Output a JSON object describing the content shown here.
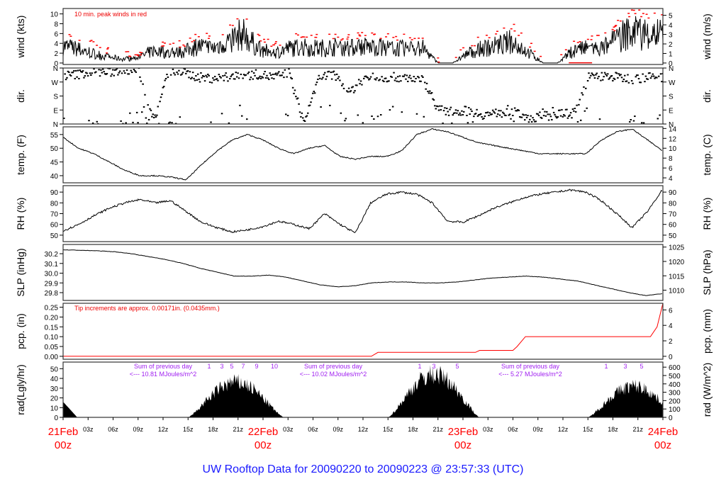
{
  "chart_data": {
    "type": "line",
    "title": "UW Rooftop Data for 20090220  to  20090223 @ 23:57:33  (UTC)",
    "x_hours_step": 3,
    "x_ticks": [
      "03z",
      "06z",
      "09z",
      "12z",
      "15z",
      "18z",
      "21z"
    ],
    "date_labels": [
      {
        "date": "21Feb",
        "hour": "00z"
      },
      {
        "date": "22Feb",
        "hour": "00z"
      },
      {
        "date": "23Feb",
        "hour": "00z"
      },
      {
        "date": "24Feb",
        "hour": "00z"
      }
    ],
    "panels": [
      {
        "id": "wind",
        "ylabel": "wind (kts)",
        "ylabel_right": "wind (m/s)",
        "ylim": [
          -0.3,
          11.1
        ],
        "ticks": [
          "0",
          "2",
          "4",
          "6",
          "8",
          "10"
        ],
        "tick_values": [
          0,
          2,
          4,
          6,
          8,
          10
        ],
        "ticks_right": [
          "0",
          "1",
          "2",
          "3",
          "4",
          "5"
        ],
        "note": "10 min. peak winds in red",
        "values": [
          3.5,
          2.8,
          2,
          1.2,
          0.8,
          1,
          2.5,
          2,
          2.2,
          3.5,
          3,
          4.5,
          6,
          3,
          2,
          3,
          3.2,
          3,
          3.3,
          3,
          3.4,
          3.2,
          3,
          3,
          3,
          0,
          0,
          2,
          3,
          3.5,
          4.5,
          2.2,
          0,
          0,
          2.5,
          3,
          3,
          5,
          6.5,
          6
        ]
      },
      {
        "id": "dir",
        "ylabel": "dir.",
        "ylabel_right": "dir.",
        "ylim": [
          0,
          360
        ],
        "ticks": [
          "N",
          "E",
          "S",
          "W",
          "N"
        ],
        "tick_values": [
          0,
          90,
          180,
          270,
          360
        ],
        "values": [
          310,
          320,
          340,
          330,
          350,
          340,
          20,
          345,
          330,
          300,
          295,
          300,
          310,
          320,
          300,
          330,
          10,
          300,
          320,
          200,
          290,
          300,
          300,
          300,
          280,
          90,
          80,
          85,
          60,
          70,
          75,
          40,
          50,
          60,
          70,
          300,
          310,
          300,
          290,
          300
        ]
      },
      {
        "id": "temp",
        "ylabel": "temp. (F)",
        "ylabel_right": "temp. (C)",
        "ylim": [
          37.4,
          57.8
        ],
        "ticks": [
          "40",
          "45",
          "50",
          "55"
        ],
        "tick_values": [
          40,
          45,
          50,
          55
        ],
        "ticks_right": [
          "4",
          "6",
          "8",
          "10",
          "12",
          "14"
        ],
        "values": [
          54,
          50,
          48,
          45,
          42,
          40,
          40,
          39.5,
          38.5,
          44,
          49,
          53,
          55,
          53,
          50,
          48,
          50,
          51,
          47,
          46,
          47,
          47,
          49,
          55,
          57,
          56,
          54,
          52,
          51,
          50,
          49,
          48,
          48,
          48,
          48,
          53,
          56,
          57,
          53,
          49
        ]
      },
      {
        "id": "rh",
        "ylabel": "RH (%)",
        "ylabel_right": "RH (%)",
        "ylim": [
          44,
          96
        ],
        "ticks": [
          "50",
          "60",
          "70",
          "80",
          "90"
        ],
        "tick_values": [
          50,
          60,
          70,
          80,
          90
        ],
        "values": [
          54,
          60,
          68,
          75,
          80,
          83,
          80,
          82,
          72,
          62,
          57,
          53,
          55,
          58,
          63,
          60,
          56,
          70,
          60,
          52,
          80,
          88,
          90,
          88,
          80,
          63,
          62,
          68,
          75,
          80,
          85,
          88,
          90,
          92,
          90,
          82,
          70,
          57,
          72,
          93
        ]
      },
      {
        "id": "slp",
        "ylabel": "SLP (inHg)",
        "ylabel_right": "SLP (hPa)",
        "ylim": [
          29.72,
          30.295
        ],
        "ticks": [
          "29.8",
          "29.9",
          "30.0",
          "30.1",
          "30.2"
        ],
        "tick_values": [
          29.8,
          29.9,
          30,
          30.1,
          30.2
        ],
        "ticks_right": [
          "1010",
          "1015",
          "1020",
          "1025"
        ],
        "values": [
          30.24,
          30.235,
          30.23,
          30.22,
          30.2,
          30.17,
          30.14,
          30.1,
          30.05,
          30.01,
          29.97,
          29.97,
          29.98,
          29.96,
          29.92,
          29.88,
          29.86,
          29.87,
          29.9,
          29.91,
          29.91,
          29.9,
          29.9,
          29.91,
          29.93,
          29.95,
          29.96,
          29.97,
          29.96,
          29.94,
          29.92,
          29.88,
          29.84,
          29.8,
          29.77,
          29.79
        ]
      },
      {
        "id": "pcp",
        "ylabel": "pcp. (in)",
        "ylabel_right": "pcp. (mm)",
        "ylim": [
          -0.015,
          0.27
        ],
        "ticks": [
          "0.00",
          "0.05",
          "0.10",
          "0.15",
          "0.20",
          "0.25"
        ],
        "tick_values": [
          0,
          0.05,
          0.1,
          0.15,
          0.2,
          0.25
        ],
        "ticks_right": [
          "0",
          "2",
          "4",
          "6"
        ],
        "note": "Tip increments are approx. 0.00171in. (0.0435mm.)",
        "steps": [
          [
            0,
            0
          ],
          [
            37,
            0
          ],
          [
            37.8,
            0.02
          ],
          [
            49.5,
            0.02
          ],
          [
            50,
            0.03
          ],
          [
            54,
            0.03
          ],
          [
            54.5,
            0.05
          ],
          [
            55.5,
            0.1
          ],
          [
            70.5,
            0.1
          ],
          [
            71.3,
            0.15
          ],
          [
            72,
            0.27
          ]
        ]
      },
      {
        "id": "rad",
        "ylabel": "rad(Lgly/hr)",
        "ylabel_right": "rad (W/m^2)",
        "ylim": [
          0,
          56.8
        ],
        "ticks": [
          "0",
          "10",
          "20",
          "30",
          "40",
          "50"
        ],
        "tick_values": [
          0,
          10,
          20,
          30,
          40,
          50
        ],
        "ticks_right": [
          "0",
          "100",
          "200",
          "300",
          "400",
          "500",
          "600"
        ],
        "days": [
          {
            "start": 15,
            "end": 26.5,
            "peak": 45
          },
          {
            "start": 39,
            "end": 50,
            "peak": 55
          },
          {
            "start": 63,
            "end": 74,
            "peak": 40
          }
        ],
        "sums": [
          {
            "line1": "Sum of previous day",
            "line2": "<--- 10.81 MJoules/m^2"
          },
          {
            "line1": "Sum of previous day",
            "line2": "<--- 10.02 MJoules/m^2"
          },
          {
            "line1": "Sum of previous day",
            "line2": "<--- 5.27 MJoules/m^2"
          }
        ],
        "hour_marks": [
          [
            "1",
            "3",
            "5",
            "7",
            "9",
            "10"
          ],
          [
            "1",
            "3",
            "5"
          ],
          [
            "1",
            "3",
            "5"
          ]
        ]
      }
    ]
  }
}
